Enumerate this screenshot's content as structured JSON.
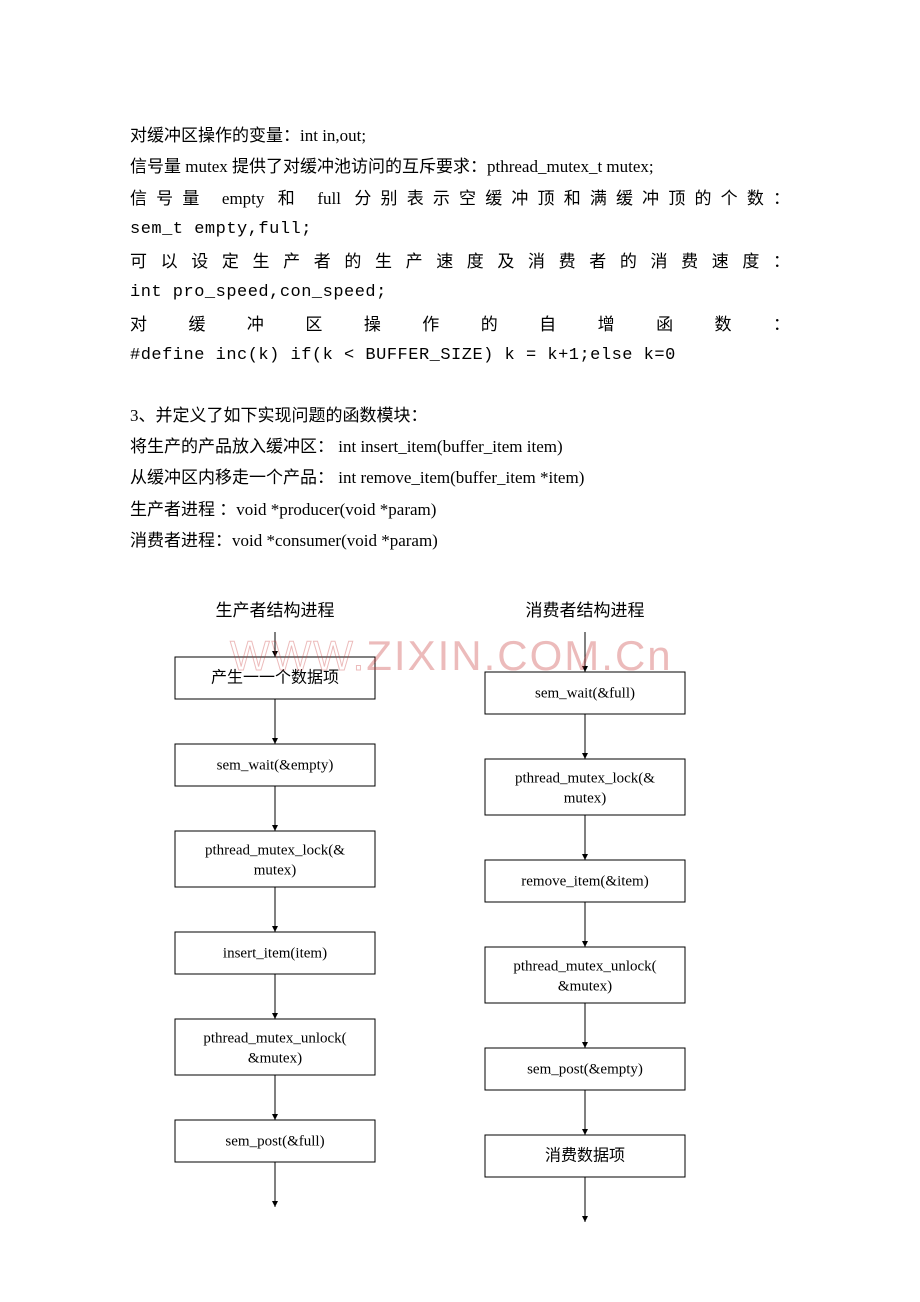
{
  "lines": {
    "l1": "对缓冲区操作的变量：int in,out;",
    "l2": "信号量 mutex 提供了对缓冲池访问的互斥要求：pthread_mutex_t mutex;",
    "l3a": "信号量 empty 和 full 分别表示空缓冲顶和满缓冲顶的个数：",
    "l3b": "sem_t empty,full;",
    "l4a": "可以设定生产者的生产速度及消费者的消费速度：",
    "l4b": "int pro_speed,con_speed;",
    "l5a": "对缓冲区操作的自增函数：",
    "l5b": "#define inc(k) if(k < BUFFER_SIZE) k = k+1;else k=0",
    "s3": "3、并定义了如下实现问题的函数模块：",
    "f1": "将生产的产品放入缓冲区： int insert_item(buffer_item item)",
    "f2": "从缓冲区内移走一个产品： int remove_item(buffer_item *item)",
    "f3": "生产者进程 ：void *producer(void *param)",
    "f4": " 消费者进程：void *consumer(void *param)"
  },
  "diagram": {
    "producer_title": "生产者结构进程",
    "consumer_title": "消费者结构进程",
    "producer_steps": [
      "产生一一个数据项",
      "sem_wait(&empty)",
      "pthread_mutex_lock(&\nmutex)",
      "insert_item(item)",
      "pthread_mutex_unlock(\n&mutex)",
      "sem_post(&full)"
    ],
    "consumer_steps": [
      "sem_wait(&full)",
      "pthread_mutex_lock(&\nmutex)",
      "remove_item(&item)",
      "pthread_mutex_unlock(\n&mutex)",
      "sem_post(&empty)",
      "消费数据项"
    ]
  },
  "watermark": {
    "prefix": "WWW.",
    "main": "ZIXIN.COM.Cn"
  }
}
